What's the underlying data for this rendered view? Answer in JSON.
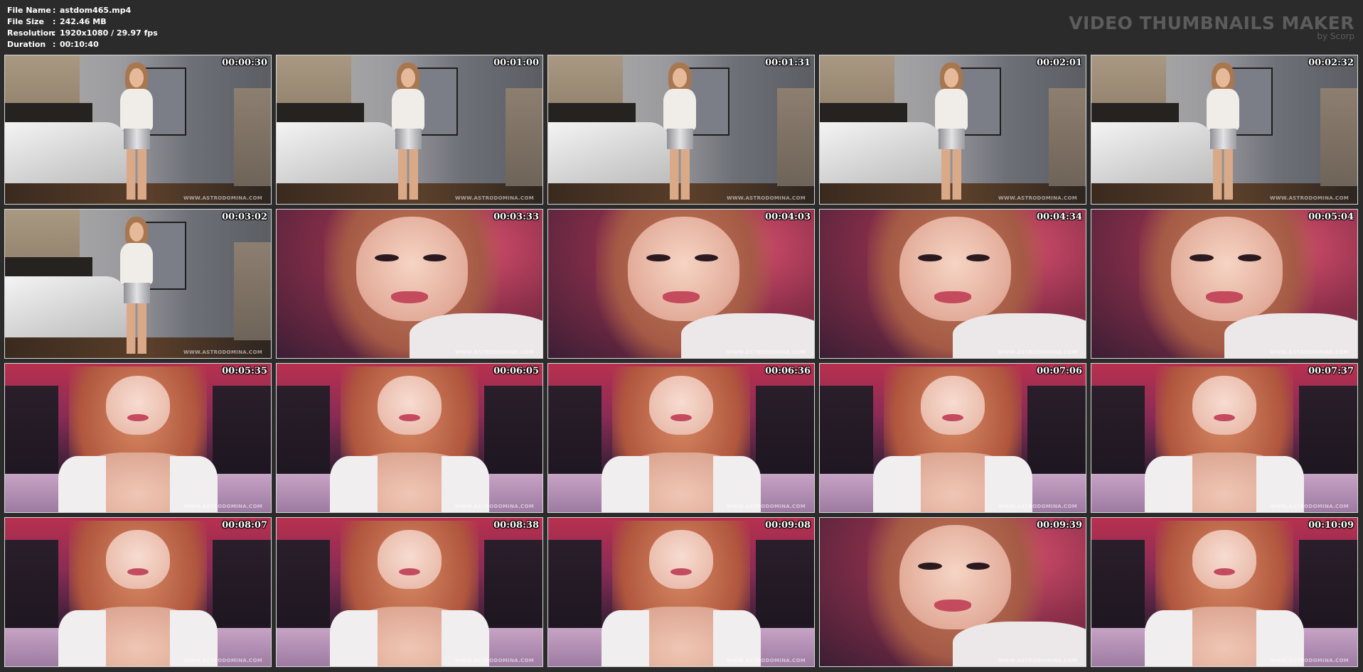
{
  "info": {
    "rows": [
      {
        "label": "File Name",
        "sep": ":",
        "value": "astdom465.mp4"
      },
      {
        "label": "File Size",
        "sep": ":",
        "value": "242.46 MB"
      },
      {
        "label": "Resolution",
        "sep": ":",
        "value": "1920x1080 / 29.97 fps"
      },
      {
        "label": "Duration",
        "sep": ":",
        "value": "00:10:40"
      }
    ]
  },
  "brand": {
    "title": "VIDEO THUMBNAILS MAKER",
    "subtitle": "by Scorp"
  },
  "watermark": "WWW.ASTRODOMINA.COM",
  "thumbnails": [
    {
      "time": "00:00:30",
      "scene": "bedroom"
    },
    {
      "time": "00:01:00",
      "scene": "bedroom"
    },
    {
      "time": "00:01:31",
      "scene": "bedroom"
    },
    {
      "time": "00:02:01",
      "scene": "bedroom"
    },
    {
      "time": "00:02:32",
      "scene": "bedroom"
    },
    {
      "time": "00:03:02",
      "scene": "bedroom"
    },
    {
      "time": "00:03:33",
      "scene": "closeup"
    },
    {
      "time": "00:04:03",
      "scene": "closeup"
    },
    {
      "time": "00:04:34",
      "scene": "closeup"
    },
    {
      "time": "00:05:04",
      "scene": "closeup"
    },
    {
      "time": "00:05:35",
      "scene": "medium"
    },
    {
      "time": "00:06:05",
      "scene": "medium"
    },
    {
      "time": "00:06:36",
      "scene": "medium"
    },
    {
      "time": "00:07:06",
      "scene": "medium"
    },
    {
      "time": "00:07:37",
      "scene": "medium"
    },
    {
      "time": "00:08:07",
      "scene": "medium"
    },
    {
      "time": "00:08:38",
      "scene": "medium"
    },
    {
      "time": "00:09:08",
      "scene": "medium"
    },
    {
      "time": "00:09:39",
      "scene": "closeup"
    },
    {
      "time": "00:10:09",
      "scene": "medium"
    }
  ]
}
